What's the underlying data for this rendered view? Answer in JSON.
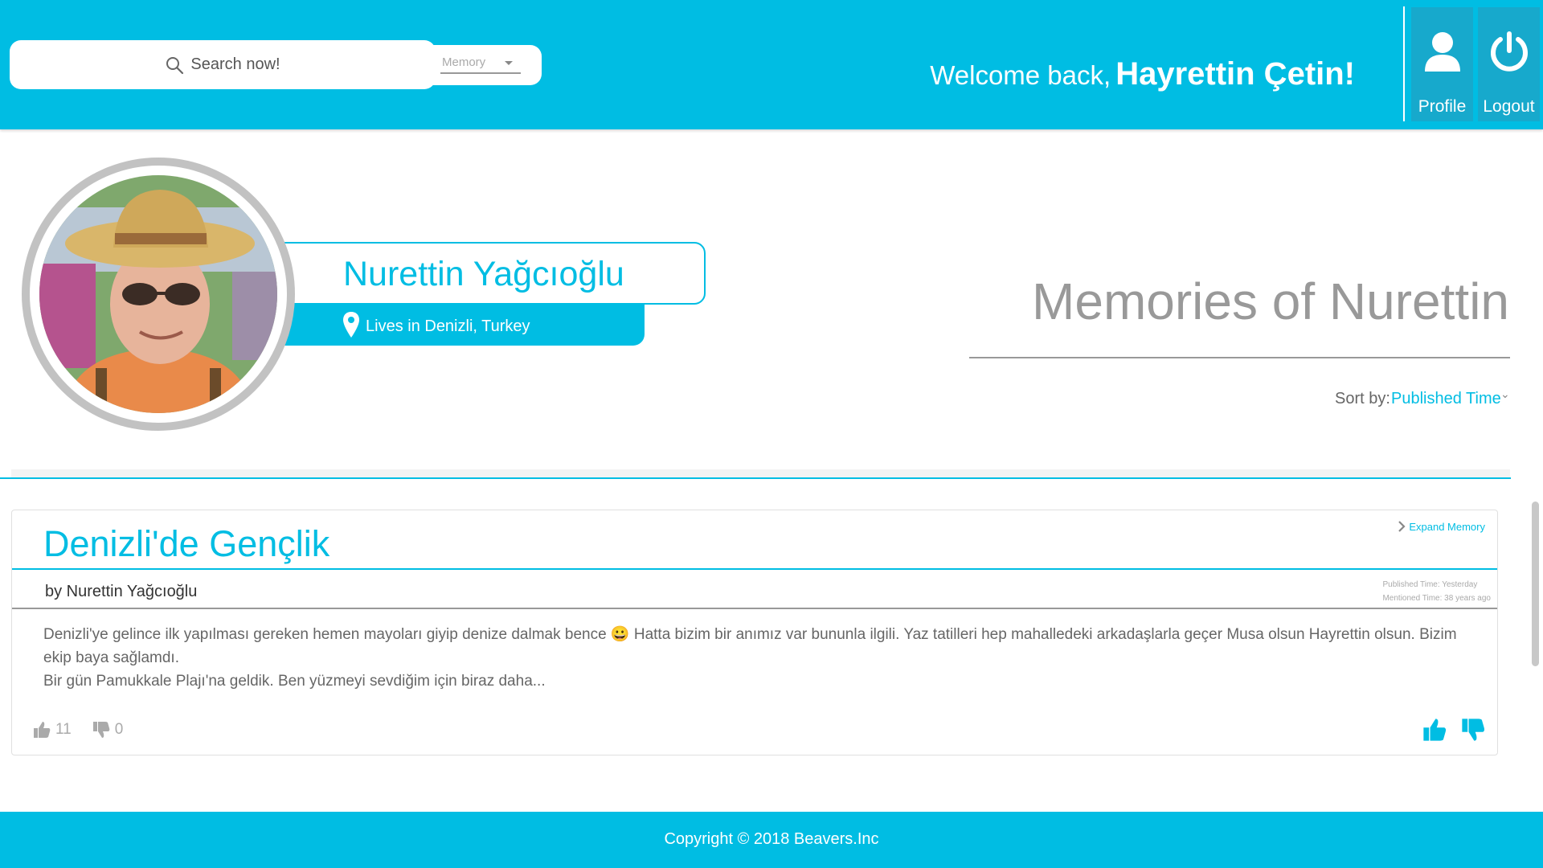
{
  "header": {
    "search_placeholder": "Search now!",
    "search_category": "Memory",
    "welcome_prefix": "Welcome back,",
    "user_name": "Hayrettin Çetin!",
    "profile_label": "Profile",
    "logout_label": "Logout"
  },
  "profile": {
    "name": "Nurettin Yağcıoğlu",
    "location": "Lives in Denizli, Turkey",
    "memories_title": "Memories of Nurettin",
    "sort_label": "Sort by:",
    "sort_value": "Published Time"
  },
  "memory": {
    "title": "Denizli'de Gençlik",
    "expand_label": "Expand Memory",
    "author": "by Nurettin Yağcıoğlu",
    "published_time": "Published Time: Yesterday",
    "mentioned_time": "Mentioned Time: 38 years ago",
    "body_line1": "Denizli'ye gelince ilk yapılması gereken hemen mayoları giyip denize dalmak bence 😀  Hatta bizim bir anımız var bununla ilgili. Yaz tatilleri hep mahalledeki arkadaşlarla geçer Musa olsun Hayrettin olsun. Bizim ekip baya sağlamdı.",
    "body_line2": "Bir gün Pamukkale Plajı'na geldik. Ben yüzmeyi sevdiğim için biraz daha...",
    "likes": "11",
    "dislikes": "0"
  },
  "footer": {
    "copyright": "Copyright © 2018 Beavers.Inc"
  },
  "colors": {
    "accent": "#00bde3",
    "button_bg": "#17a9cc",
    "ring": "#c2c2c2"
  },
  "icons": {
    "search": "search-icon",
    "profile": "user-icon",
    "logout": "power-icon",
    "location": "map-pin-icon",
    "expand": "chevron-right-icon",
    "like": "thumbs-up-icon",
    "dislike": "thumbs-down-icon"
  }
}
